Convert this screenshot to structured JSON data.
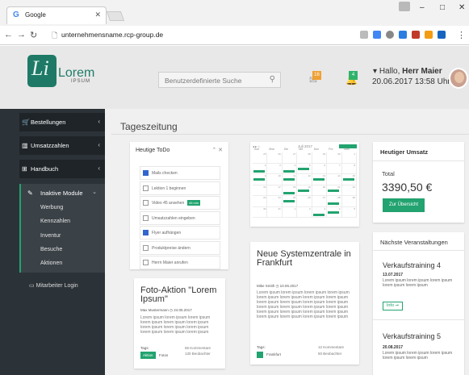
{
  "browser": {
    "tab_title": "Google",
    "tab_icon": "G",
    "url": "unternehmensname.rcp-group.de",
    "window_buttons": {
      "minimize": "–",
      "maximize": "□",
      "close": "✕"
    }
  },
  "header": {
    "logo_letter": "Li",
    "logo_word": "Lorem",
    "logo_sub": "IPSUM",
    "search_placeholder": "Benutzerdefinierte Suche",
    "mail_count": "16",
    "notify_count": "4",
    "greeting_prefix": "Hallo,",
    "user_name": "Herr Maier",
    "datetime": "20.06.2017 13:58 Uhr"
  },
  "sidebar": {
    "items": [
      {
        "label": "Bestellungen",
        "icon": "cart-icon"
      },
      {
        "label": "Umsatzzahlen",
        "icon": "chart-icon"
      },
      {
        "label": "Handbuch",
        "icon": "book-icon"
      }
    ],
    "group": {
      "label": "Inaktive Module",
      "subitems": [
        "Werbung",
        "Kennzahlen",
        "Inventur",
        "Besuche",
        "Aktionen"
      ]
    },
    "login": "Mitarbeiter Login"
  },
  "page": {
    "title": "Tageszeitung"
  },
  "todo": {
    "title": "Heutige ToDo",
    "items": [
      {
        "text": "Mails checken",
        "checked": true
      },
      {
        "text": "Lektion 1 beginnen",
        "checked": false
      },
      {
        "text": "Video 45 ansehen",
        "checked": false,
        "tag": "45 min"
      },
      {
        "text": "Umsatzzahlen eingeben",
        "checked": false
      },
      {
        "text": "Flyer aufhängen",
        "checked": true
      },
      {
        "text": "Produktpreise ändern",
        "checked": false
      },
      {
        "text": "Herrn Maier anrufen",
        "checked": false
      }
    ]
  },
  "calendar": {
    "month_label": "Juli 2017",
    "weekdays": [
      "Son",
      "Mon",
      "Die",
      "Mit",
      "Don",
      "Fre",
      "Sam"
    ],
    "days": [
      "25",
      "26",
      "27",
      "28",
      "29",
      "30",
      "1",
      "2",
      "3",
      "4",
      "5",
      "6",
      "7",
      "8",
      "9",
      "10",
      "11",
      "12",
      "13",
      "14",
      "15",
      "16",
      "17",
      "18",
      "19",
      "20",
      "21",
      "22",
      "23",
      "24",
      "25",
      "26",
      "27",
      "28",
      "29",
      "30",
      "31",
      "1",
      "2",
      "3",
      "4",
      "5"
    ]
  },
  "umsatz": {
    "title": "Heutiger Umsatz",
    "label": "Total",
    "value": "3390,50 €",
    "button": "Zur Übersicht"
  },
  "events": {
    "title": "Nächste Veranstaltungen",
    "items": [
      {
        "title": "Verkaufstraining 4",
        "date": "13.07.2017",
        "text": "Lorem ipsum lorem ipsum lorem ipsum lorem ipsum lorem ipsum",
        "button": "Info ➞"
      },
      {
        "title": "Verkaufstraining 5",
        "date": "20.08.2017",
        "text": "Lorem ipsum lorem ipsum lorem ipsum lorem ipsum lorem ipsum"
      }
    ]
  },
  "articles": [
    {
      "title": "Foto-Aktion \"Lorem Ipsum\"",
      "meta": "Max Mustermann ◷ 24.05.2017",
      "body": "Lorem ipsum lorem ipsum lorem ipsum lorem ipsum lorem ipsum lorem ipsum lorem ipsum lorem ipsum lorem ipsum lorem ipsum lorem ipsum lorem ipsum",
      "tags_label": "Tags:",
      "tags": [
        "Aktion",
        "Fotos"
      ],
      "comments": "56 Kommentare",
      "views": "130 Beobachter"
    },
    {
      "title": "Neue Systemzentrale in Frankfurt",
      "meta": "Mike Smith ◷ 10.06.2017",
      "body": "Lorem ipsum lorem ipsum lorem ipsum lorem ipsum lorem ipsum lorem ipsum lorem ipsum lorem ipsum lorem ipsum lorem ipsum lorem ipsum lorem ipsum lorem ipsum lorem ipsum lorem ipsum lorem ipsum lorem ipsum lorem ipsum lorem ipsum lorem ipsum lorem ipsum lorem ipsum lorem ipsum lorem ipsum",
      "tags_label": "Tags:",
      "tags": [
        "Frankfurt"
      ],
      "comments": "12 Kommentare",
      "views": "50 Beobachter"
    }
  ],
  "colors": {
    "accent": "#22a36f",
    "sidebar": "#2c3338",
    "badge_orange": "#f0a033"
  }
}
